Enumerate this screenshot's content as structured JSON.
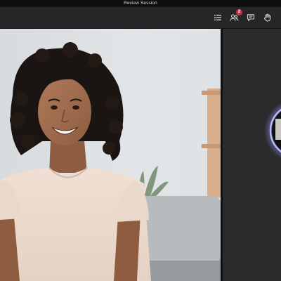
{
  "window": {
    "title": "Review Session"
  },
  "toolbar": {
    "participants_icon": "participants-icon",
    "participants_badge": "2",
    "list_icon": "list-icon",
    "chat_icon": "chat-icon",
    "raise_hand_icon": "raise-hand-icon"
  },
  "stage": {
    "main_video": "participant-video-woman",
    "side_video": "participant-avatar-tile"
  },
  "colors": {
    "titlebar_bg": "#0f0f10",
    "toolbar_bg": "#262628",
    "side_panel_bg": "#2b2b2e",
    "badge_red": "#c4314b",
    "avatar_ring": "#8b8ff0"
  }
}
